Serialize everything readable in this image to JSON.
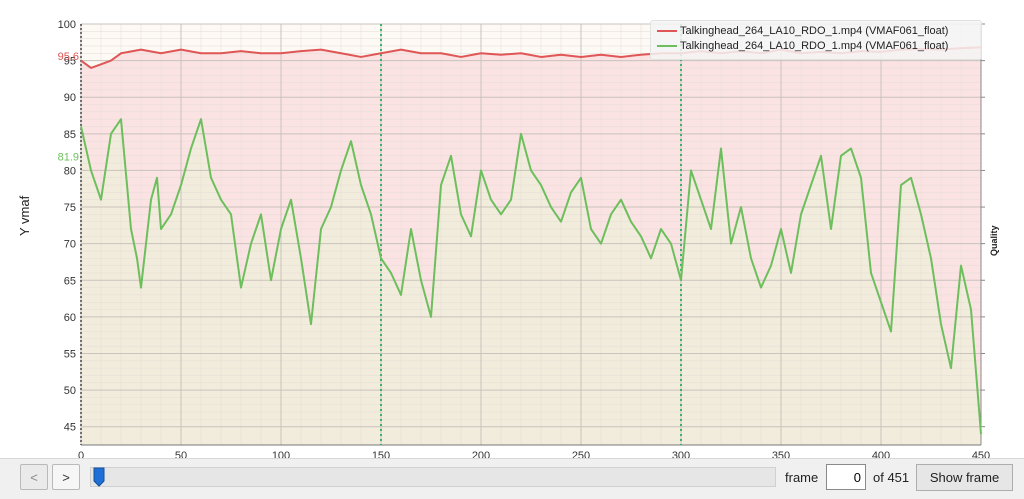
{
  "chart_data": {
    "type": "line",
    "ylabel": "Y vmaf",
    "y2label": "Quality",
    "xlim": [
      0,
      450
    ],
    "ylim": [
      42.5,
      100
    ],
    "xticks": [
      0,
      50,
      100,
      150,
      200,
      250,
      300,
      350,
      400,
      450
    ],
    "yticks": [
      45,
      50,
      55,
      60,
      65,
      70,
      75,
      80,
      85,
      90,
      95,
      100
    ],
    "grid": true,
    "legend_position": "top-right",
    "markers_x": [
      150,
      300
    ],
    "series": [
      {
        "name": "Talkinghead_264_LA10_RDO_1.mp4 (VMAF061_float)",
        "color": "#e05555",
        "fill": "#fbe3e3",
        "mean_label": "95.6",
        "mean": 95.6,
        "x": [
          0,
          5,
          10,
          15,
          20,
          30,
          40,
          50,
          60,
          70,
          80,
          90,
          100,
          110,
          120,
          130,
          140,
          150,
          160,
          170,
          180,
          190,
          200,
          210,
          220,
          230,
          240,
          250,
          260,
          270,
          280,
          290,
          300,
          310,
          320,
          330,
          340,
          350,
          360,
          370,
          380,
          390,
          400,
          410,
          420,
          430,
          440,
          450
        ],
        "values": [
          95,
          94,
          94.5,
          95,
          96,
          96.5,
          96,
          96.5,
          96,
          96,
          96.3,
          96,
          96,
          96.3,
          96.5,
          96,
          95.5,
          96,
          96.5,
          96,
          96,
          95.5,
          96,
          95.8,
          96,
          95.5,
          95.8,
          95.5,
          95.8,
          95.5,
          95.8,
          96,
          96,
          96.3,
          96,
          96.3,
          96,
          96.5,
          96,
          96.2,
          96,
          96.3,
          96.2,
          96.5,
          96.6,
          96.5,
          96.7,
          96.8
        ]
      },
      {
        "name": "Talkinghead_264_LA10_RDO_1.mp4 (VMAF061_float)",
        "color": "#6cbf5c",
        "fill": "#f2ecdc",
        "mean_label": "81.9",
        "mean": 81.9,
        "x": [
          0,
          5,
          10,
          15,
          20,
          25,
          28,
          30,
          35,
          38,
          40,
          45,
          50,
          55,
          60,
          65,
          70,
          75,
          80,
          85,
          90,
          95,
          100,
          105,
          110,
          115,
          120,
          125,
          130,
          135,
          140,
          145,
          150,
          155,
          160,
          165,
          170,
          175,
          180,
          185,
          190,
          195,
          200,
          205,
          210,
          215,
          220,
          225,
          230,
          235,
          240,
          245,
          250,
          255,
          260,
          265,
          270,
          275,
          280,
          285,
          290,
          295,
          300,
          305,
          310,
          315,
          320,
          325,
          330,
          335,
          340,
          345,
          350,
          355,
          360,
          365,
          370,
          375,
          380,
          385,
          390,
          395,
          400,
          405,
          410,
          415,
          420,
          425,
          430,
          435,
          440,
          445,
          450
        ],
        "values": [
          86,
          80,
          76,
          85,
          87,
          72,
          68,
          64,
          76,
          79,
          72,
          74,
          78,
          83,
          87,
          79,
          76,
          74,
          64,
          70,
          74,
          65,
          72,
          76,
          68,
          59,
          72,
          75,
          80,
          84,
          78,
          74,
          68,
          66,
          63,
          72,
          65,
          60,
          78,
          82,
          74,
          71,
          80,
          76,
          74,
          76,
          85,
          80,
          78,
          75,
          73,
          77,
          79,
          72,
          70,
          74,
          76,
          73,
          71,
          68,
          72,
          70,
          65,
          80,
          76,
          72,
          83,
          70,
          75,
          68,
          64,
          67,
          72,
          66,
          74,
          78,
          82,
          72,
          82,
          83,
          79,
          66,
          62,
          58,
          78,
          79,
          74,
          68,
          59,
          53,
          67,
          61,
          44
        ]
      }
    ]
  },
  "controls": {
    "prev_label": "<",
    "next_label": ">",
    "slider_value": 0,
    "frame_label": "frame",
    "frame_value": "0",
    "of_label": "of 451",
    "show_frame_label": "Show frame"
  }
}
